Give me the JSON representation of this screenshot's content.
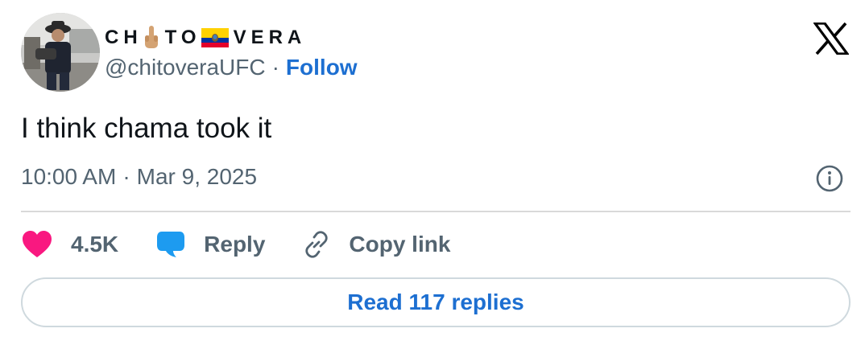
{
  "author": {
    "name_part1": "CH",
    "name_emoji_1": "middle-finger-emoji",
    "name_part2": "TO",
    "name_emoji_2": "ecuador-flag-emoji",
    "name_part3": "VERA",
    "handle": "@chitoveraUFC",
    "separator": "·",
    "follow_label": "Follow"
  },
  "tweet": {
    "text": "I think chama took it",
    "time": "10:00 AM",
    "separator": "·",
    "date": "Mar 9, 2025"
  },
  "actions": {
    "likes_count": "4.5K",
    "reply_label": "Reply",
    "copy_link_label": "Copy link"
  },
  "read_replies_label": "Read 117 replies",
  "colors": {
    "accent": "#1d6fd1",
    "like": "#f91880",
    "reply_bubble": "#1d9bf0",
    "secondary_text": "#536471",
    "primary_text": "#0f1419",
    "border": "#cfd9de"
  }
}
